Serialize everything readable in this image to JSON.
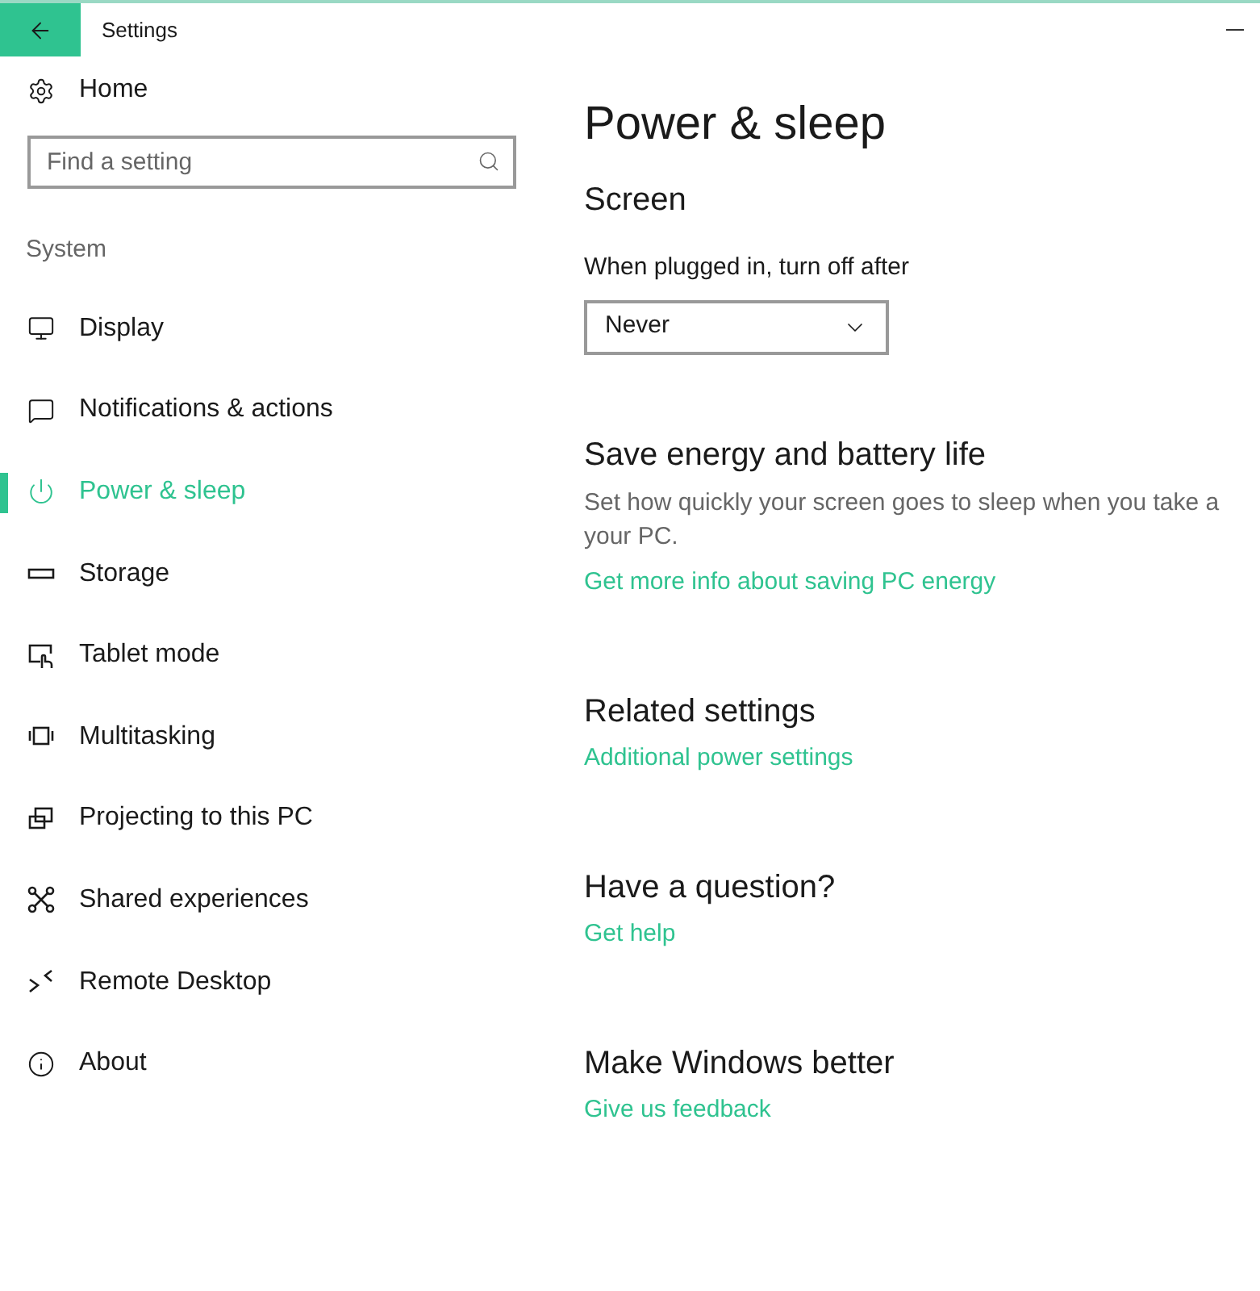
{
  "window": {
    "title": "Settings"
  },
  "sidebar": {
    "home": "Home",
    "search": {
      "placeholder": "Find a setting"
    },
    "section": "System",
    "items": [
      {
        "label": "Display",
        "selected": false
      },
      {
        "label": "Notifications & actions",
        "selected": false
      },
      {
        "label": "Power & sleep",
        "selected": true
      },
      {
        "label": "Storage",
        "selected": false
      },
      {
        "label": "Tablet mode",
        "selected": false
      },
      {
        "label": "Multitasking",
        "selected": false
      },
      {
        "label": "Projecting to this PC",
        "selected": false
      },
      {
        "label": "Shared experiences",
        "selected": false
      },
      {
        "label": "Remote Desktop",
        "selected": false
      },
      {
        "label": "About",
        "selected": false
      }
    ]
  },
  "content": {
    "title": "Power & sleep",
    "screen": {
      "heading": "Screen",
      "label": "When plugged in, turn off after",
      "value": "Never"
    },
    "sections": [
      {
        "heading": "Save energy and battery life",
        "lines": [
          "Set how quickly your screen goes to sleep when you take a",
          "your PC."
        ],
        "link": "Get more info about saving PC energy"
      },
      {
        "heading": "Related settings",
        "link": "Additional power settings"
      },
      {
        "heading": "Have a question?",
        "link": "Get help"
      },
      {
        "heading": "Make Windows better",
        "link": "Give us feedback"
      }
    ]
  }
}
